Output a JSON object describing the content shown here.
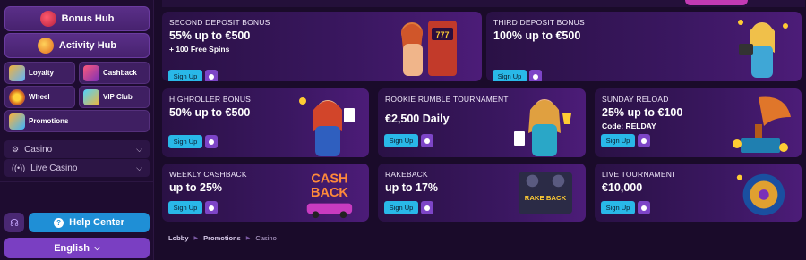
{
  "sidebar": {
    "hubs": [
      {
        "label": "Bonus Hub",
        "icon": "gift-icon"
      },
      {
        "label": "Activity Hub",
        "icon": "controller-icon"
      }
    ],
    "tiles": [
      {
        "label": "Loyalty",
        "icon": "loyalty-icon"
      },
      {
        "label": "Cashback",
        "icon": "cashback-icon"
      },
      {
        "label": "Wheel",
        "icon": "wheel-icon"
      },
      {
        "label": "VIP Club",
        "icon": "vip-icon"
      },
      {
        "label": "Promotions",
        "icon": "promotions-icon"
      }
    ],
    "dropdowns": [
      {
        "label": "Casino",
        "icon": "gear-icon"
      },
      {
        "label": "Live Casino",
        "icon": "broadcast-icon"
      }
    ],
    "help_label": "Help Center",
    "language": "English"
  },
  "cards": [
    {
      "title": "SECOND DEPOSIT BONUS",
      "amount": "55% up to €500",
      "sub": "+ 100 Free Spins",
      "signup": "Sign Up"
    },
    {
      "title": "THIRD DEPOSIT BONUS",
      "amount": "100% up to €500",
      "sub": "",
      "signup": "Sign Up"
    },
    {
      "title": "HIGHROLLER BONUS",
      "amount": "50% up to €500",
      "sub": "",
      "signup": "Sign Up"
    },
    {
      "title": "ROOKIE RUMBLE TOURNAMENT",
      "amount": "€2,500 Daily",
      "sub": "",
      "signup": "Sign Up"
    },
    {
      "title": "SUNDAY RELOAD",
      "amount": "25% up to €100",
      "sub": "Code: RELDAY",
      "signup": "Sign Up"
    },
    {
      "title": "WEEKLY CASHBACK",
      "amount": "up to 25%",
      "sub": "",
      "signup": "Sign Up"
    },
    {
      "title": "RAKEBACK",
      "amount": "up to 17%",
      "sub": "",
      "signup": "Sign Up"
    },
    {
      "title": "LIVE TOURNAMENT",
      "amount": "€10,000",
      "sub": "",
      "signup": "Sign Up"
    }
  ],
  "art": {
    "slot_reels": "777",
    "cashback_line1": "CASH",
    "cashback_line2": "BACK",
    "rakeback_line1": "RAKE BACK"
  },
  "breadcrumb": [
    "Lobby",
    "Promotions",
    "Casino"
  ],
  "colors": {
    "accent": "#29b8e8",
    "purple": "#7d45c7",
    "help": "#1f8fd6"
  }
}
